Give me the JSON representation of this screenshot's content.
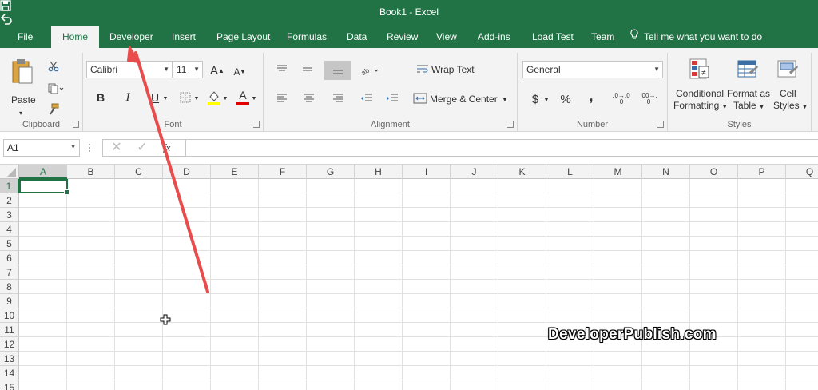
{
  "window": {
    "title": "Book1 - Excel"
  },
  "tabs": [
    "File",
    "Home",
    "Developer",
    "Insert",
    "Page Layout",
    "Formulas",
    "Data",
    "Review",
    "View",
    "Add-ins",
    "Load Test",
    "Team"
  ],
  "active_tab": "Home",
  "tell_me": "Tell me what you want to do",
  "ribbon": {
    "clipboard": {
      "label": "Clipboard",
      "paste": "Paste"
    },
    "font": {
      "label": "Font",
      "name": "Calibri",
      "size": "11",
      "bold": "B",
      "italic": "I",
      "underline": "U",
      "grow": "A",
      "shrink": "A",
      "color_a": "A"
    },
    "alignment": {
      "label": "Alignment",
      "wrap_text": "Wrap Text",
      "merge_center": "Merge & Center"
    },
    "number": {
      "label": "Number",
      "format": "General",
      "currency": "$",
      "percent": "%",
      "comma": ",",
      "inc_decimal": ".0→.00",
      "dec_decimal": ".00→.0"
    },
    "styles": {
      "label": "Styles",
      "conditional": "Conditional",
      "formatting": "Formatting",
      "format_as": "Format as",
      "table": "Table",
      "cell": "Cell",
      "styles_btn": "Styles"
    }
  },
  "formula_bar": {
    "name_box": "A1",
    "fx": "fx",
    "value": ""
  },
  "grid": {
    "columns": [
      "A",
      "B",
      "C",
      "D",
      "E",
      "F",
      "G",
      "H",
      "I",
      "J",
      "K",
      "L",
      "M",
      "N",
      "O",
      "P",
      "Q"
    ],
    "rows": [
      "1",
      "2",
      "3",
      "4",
      "5",
      "6",
      "7",
      "8",
      "9",
      "10",
      "11",
      "12",
      "13",
      "14",
      "15"
    ],
    "selected_cell": "A1"
  },
  "watermark": "DeveloperPublish.com",
  "colors": {
    "brand": "#217346",
    "arrow": "#e84c4c"
  }
}
